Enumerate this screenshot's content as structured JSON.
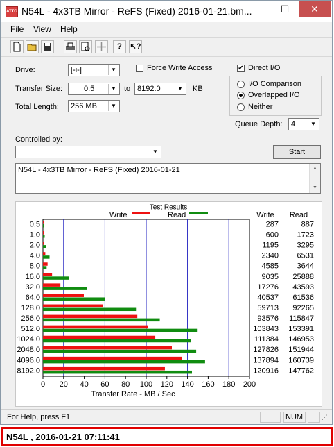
{
  "window": {
    "title": "N54L - 4x3TB Mirror - ReFS (Fixed) 2016-01-21.bm...",
    "app_icon_text": "ATTO",
    "controls": {
      "minimize": "—",
      "maximize": "☐",
      "close": "✕"
    }
  },
  "menu": {
    "file": "File",
    "view": "View",
    "help": "Help"
  },
  "toolbar": {
    "icons": [
      "new-icon",
      "open-icon",
      "save-icon",
      "print-icon",
      "print-preview-icon",
      "move-icon",
      "help-icon",
      "context-help-icon"
    ]
  },
  "form": {
    "drive_label": "Drive:",
    "drive_value": "[-i-]",
    "force_write_label": "Force Write Access",
    "force_write_checked": false,
    "direct_io_label": "Direct I/O",
    "direct_io_checked": true,
    "transfer_size_label": "Transfer Size:",
    "transfer_from": "0.5",
    "to_label": "to",
    "transfer_to": "8192.0",
    "kb_label": "KB",
    "total_length_label": "Total Length:",
    "total_length_value": "256 MB",
    "io_comparison_label": "I/O Comparison",
    "overlapped_io_label": "Overlapped I/O",
    "neither_label": "Neither",
    "selected_io_mode": "Overlapped I/O",
    "queue_depth_label": "Queue Depth:",
    "queue_depth_value": "4",
    "controlled_by_label": "Controlled by:",
    "controlled_by_value": "",
    "start_label": "Start",
    "description": "N54L - 4x3TB Mirror - ReFS (Fixed) 2016-01-21"
  },
  "results": {
    "title": "Test Results",
    "write_legend": "Write",
    "read_legend": "Read",
    "write_header": "Write",
    "read_header": "Read",
    "xlabel": "Transfer Rate - MB / Sec"
  },
  "chart_data": {
    "type": "bar",
    "title": "Test Results",
    "xlabel": "Transfer Rate - MB / Sec",
    "xlim": [
      0,
      200
    ],
    "xticks": [
      0,
      20,
      40,
      60,
      80,
      100,
      120,
      140,
      160,
      180,
      200
    ],
    "categories": [
      "0.5",
      "1.0",
      "2.0",
      "4.0",
      "8.0",
      "16.0",
      "32.0",
      "64.0",
      "128.0",
      "256.0",
      "512.0",
      "1024.0",
      "2048.0",
      "4096.0",
      "8192.0"
    ],
    "series": [
      {
        "name": "Write",
        "color": "#ee1111",
        "values": [
          287,
          600,
          1195,
          2340,
          4585,
          9035,
          17276,
          40537,
          59713,
          93576,
          103843,
          111384,
          127826,
          137894,
          120916
        ]
      },
      {
        "name": "Read",
        "color": "#108c10",
        "values": [
          887,
          1723,
          3295,
          6531,
          3644,
          25888,
          43593,
          61536,
          92265,
          115847,
          153391,
          146953,
          151944,
          160739,
          147762
        ]
      }
    ],
    "legend": "top"
  },
  "status": {
    "help_text": "For Help, press F1",
    "num": "NUM"
  },
  "caption": {
    "text": "N54L   ,  2016-01-21 07:11:41"
  }
}
